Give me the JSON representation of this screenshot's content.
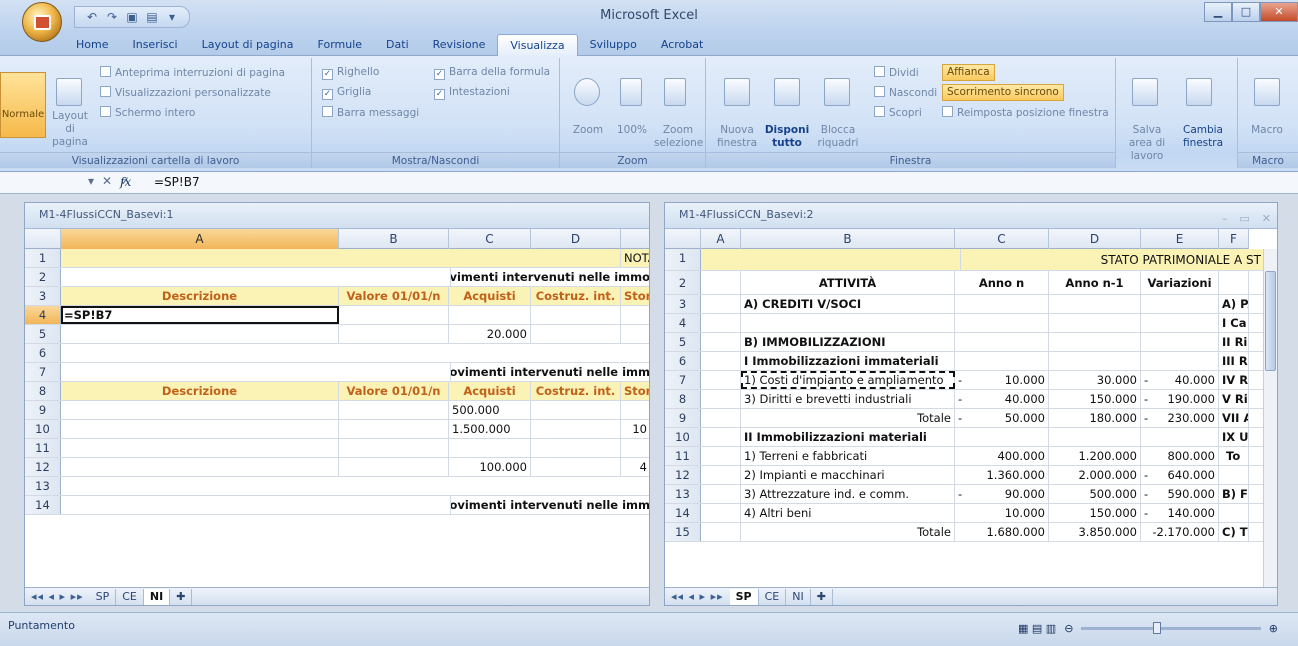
{
  "app": {
    "title": "Microsoft Excel"
  },
  "ribbon": {
    "tabs": [
      "Home",
      "Inserisci",
      "Layout di pagina",
      "Formule",
      "Dati",
      "Revisione",
      "Visualizza",
      "Sviluppo",
      "Acrobat"
    ],
    "active_tab": "Visualizza",
    "groups": {
      "views": {
        "label": "Visualizzazioni cartella di lavoro",
        "normale": "Normale",
        "layout": "Layout di pagina",
        "anteprima": "Anteprima interruzioni di pagina",
        "personalizzate": "Visualizzazioni personalizzate",
        "schermo": "Schermo intero"
      },
      "show": {
        "label": "Mostra/Nascondi",
        "righello": "Righello",
        "griglia": "Griglia",
        "barra_messaggi": "Barra messaggi",
        "barra_formula": "Barra della formula",
        "intestazioni": "Intestazioni"
      },
      "zoom": {
        "label": "Zoom",
        "zoom": "Zoom",
        "cento": "100%",
        "selezione": "Zoom selezione"
      },
      "finestra": {
        "label": "Finestra",
        "nuova": "Nuova finestra",
        "disponi": "Disponi tutto",
        "blocca": "Blocca riquadri",
        "dividi": "Dividi",
        "nascondi": "Nascondi",
        "scopri": "Scopri",
        "affianca": "Affianca",
        "scorrimento": "Scorrimento sincrono",
        "reimposta": "Reimposta posizione finestra",
        "salva": "Salva area di lavoro",
        "cambia": "Cambia finestra"
      },
      "macro": {
        "label": "Macro",
        "macro": "Macro"
      }
    }
  },
  "formula_bar": {
    "formula": "=SP!B7"
  },
  "left_window": {
    "title": "M1-4FlussiCCN_Basevi:1",
    "columns": [
      "A",
      "B",
      "C",
      "D"
    ],
    "rows": [
      "1",
      "2",
      "3",
      "4",
      "5",
      "6",
      "7",
      "8",
      "9",
      "10",
      "11",
      "12",
      "13",
      "14"
    ],
    "cells": {
      "r1": "NOTA INTEGRA",
      "r2": "Movimenti intervenuti nelle immo",
      "r3": [
        "Descrizione",
        "Valore 01/01/n",
        "Acquisti",
        "Costruz. int.",
        "Storn"
      ],
      "r4": "=SP!B7",
      "r5": "20.000",
      "r7": "Movimenti intervenuti nelle imm",
      "r8": [
        "Descrizione",
        "Valore 01/01/n",
        "Acquisti",
        "Costruz. int.",
        "Storn"
      ],
      "r9": "500.000",
      "r10": [
        "1.500.000",
        "10"
      ],
      "r12": [
        "100.000",
        "4"
      ],
      "r14": "Movimenti intervenuti nelle imm"
    },
    "sheets": [
      "SP",
      "CE",
      "NI"
    ],
    "active_sheet": "NI"
  },
  "right_window": {
    "title": "M1-4FlussiCCN_Basevi:2",
    "columns": [
      "A",
      "B",
      "C",
      "D",
      "E",
      "F"
    ],
    "header_title": "STATO PATRIMONIALE A ST",
    "col_headers": [
      "ATTIVITÀ",
      "Anno n",
      "Anno n-1",
      "Variazioni"
    ],
    "rows": [
      {
        "n": "3",
        "b": "A)  CREDITI V/SOCI",
        "bold": true,
        "g": "A)",
        "h": "PA"
      },
      {
        "n": "4",
        "b": "",
        "g": "I",
        "h": "Ca"
      },
      {
        "n": "5",
        "b": "B)  IMMOBILIZZAZIONI",
        "bold": true,
        "g": "II",
        "h": "Ri"
      },
      {
        "n": "6",
        "b": "I   Immobilizzazioni immateriali",
        "bold": true,
        "g": "III",
        "h": "Ri"
      },
      {
        "n": "7",
        "b": "1)  Costi d'impianto e ampliamento",
        "c": "10.000",
        "cs": "-",
        "d": "30.000",
        "e": "40.000",
        "es": "-",
        "g": "IV",
        "h": "Ri"
      },
      {
        "n": "8",
        "b": "3)  Diritti e brevetti industriali",
        "c": "40.000",
        "cs": "-",
        "d": "150.000",
        "e": "190.000",
        "es": "-",
        "g": "V",
        "h": "Ri"
      },
      {
        "n": "9",
        "b": "Totale",
        "right": true,
        "c": "50.000",
        "cs": "-",
        "d": "180.000",
        "e": "230.000",
        "es": "-",
        "g": "VII",
        "h": "Al"
      },
      {
        "n": "10",
        "b": "II  Immobilizzazioni materiali",
        "bold": true,
        "g": "IX",
        "h": "Ut"
      },
      {
        "n": "11",
        "b": "1)  Terreni e fabbricati",
        "c": "400.000",
        "d": "1.200.000",
        "e": "800.000",
        "h": "To"
      },
      {
        "n": "12",
        "b": "2)  Impianti e macchinari",
        "c": "1.360.000",
        "d": "2.000.000",
        "e": "640.000",
        "es": "-"
      },
      {
        "n": "13",
        "b": "3)  Attrezzature ind. e comm.",
        "c": "90.000",
        "cs": "-",
        "d": "500.000",
        "e": "590.000",
        "es": "-",
        "g": "B)",
        "h": "FC"
      },
      {
        "n": "14",
        "b": "4)  Altri beni",
        "c": "10.000",
        "d": "150.000",
        "e": "140.000",
        "es": "-"
      },
      {
        "n": "15",
        "b": "Totale",
        "right": true,
        "c": "1.680.000",
        "d": "3.850.000",
        "e": "-2.170.000",
        "g": "C)",
        "h": "TF"
      }
    ],
    "sheets": [
      "SP",
      "CE",
      "NI"
    ],
    "active_sheet": "SP"
  },
  "status": {
    "mode": "Puntamento"
  }
}
